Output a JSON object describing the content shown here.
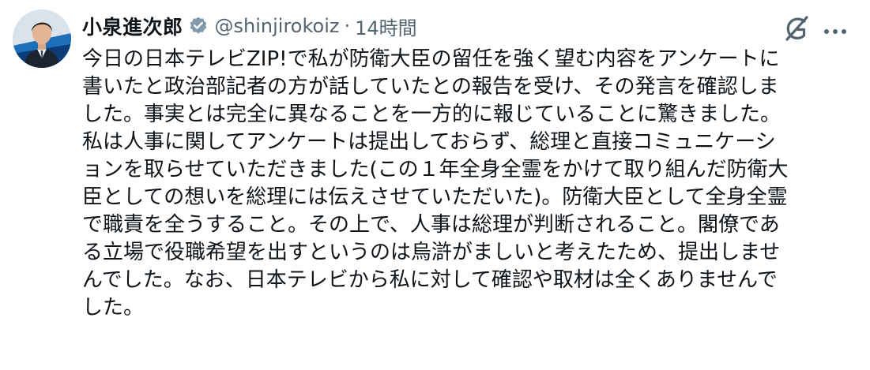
{
  "tweet": {
    "author": {
      "display_name": "小泉進次郎",
      "handle": "@shinjirokoiz",
      "avatar_icon": "avatar-photo"
    },
    "separator": "·",
    "time": "14時間",
    "icons": {
      "verified": "verified-badge-icon",
      "grok": "grok-icon",
      "more": "more-options-icon"
    },
    "colors": {
      "text": "#0f1419",
      "secondary": "#536471",
      "verified_badge": "#829aab"
    },
    "body_lines": [
      "今日の日本テレビZIP!で私が防衛大臣の留任を強く望む内容をアンケートに",
      "書いたと政治部記者の方が話していたとの報告を受け、その発言を確認しま",
      "した。事実とは完全に異なることを一方的に報じていることに驚きました。",
      "私は人事に関してアンケートは提出しておらず、総理と直接コミュニケーシ",
      "ョンを取らせていただきました(この１年全身全霊をかけて取り組んだ防衛大",
      "臣としての想いを総理には伝えさせていただいた)。防衛大臣として全身全霊",
      "で職責を全うすること。その上で、人事は総理が判断されること。閣僚であ",
      "る立場で役職希望を出すというのは烏滸がましいと考えたため、提出しませ",
      "んでした。なお、日本テレビから私に対して確認や取材は全くありませんで",
      "した。"
    ]
  }
}
